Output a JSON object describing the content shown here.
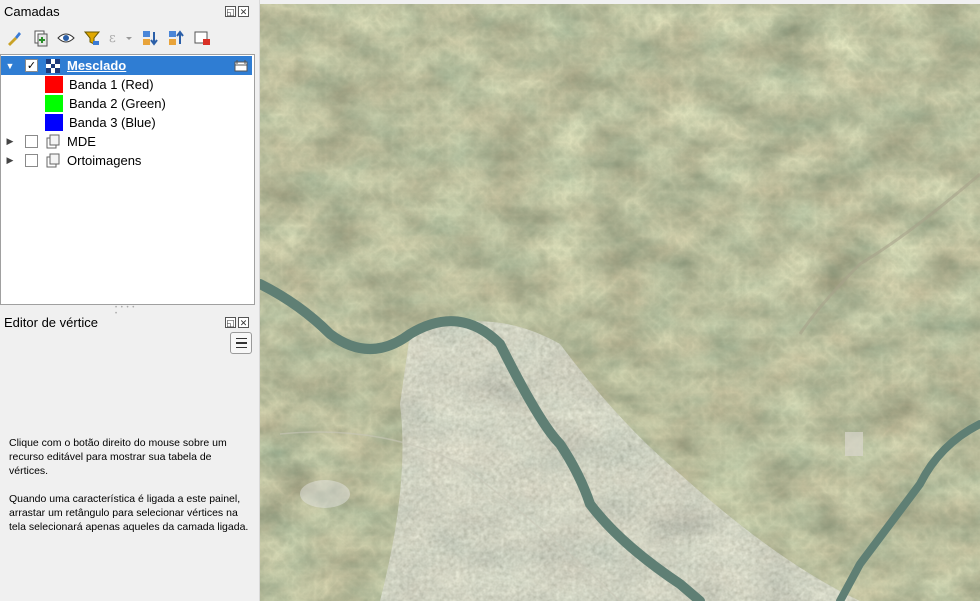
{
  "layers_panel": {
    "title": "Camadas",
    "toolbar": [
      {
        "name": "style-manager-icon"
      },
      {
        "name": "add-group-icon"
      },
      {
        "name": "visibility-eye-icon"
      },
      {
        "name": "filter-icon"
      },
      {
        "name": "expression-filter-icon"
      },
      {
        "name": "expand-all-icon"
      },
      {
        "name": "collapse-all-icon"
      },
      {
        "name": "remove-layer-icon"
      }
    ],
    "layers": [
      {
        "label": "Mesclado",
        "checked": "✓",
        "selected": true
      },
      {
        "label": "Banda 1 (Red)",
        "color": "#ff0000"
      },
      {
        "label": "Banda 2 (Green)",
        "color": "#00ff00"
      },
      {
        "label": "Banda 3 (Blue)",
        "color": "#0000ff"
      },
      {
        "label": "MDE",
        "checked": ""
      },
      {
        "label": "Ortoimagens",
        "checked": ""
      }
    ]
  },
  "vertex_editor": {
    "title": "Editor de vértice",
    "help_1": "Clique com o botão direito do mouse sobre um recurso editável para mostrar sua tabela de vértices.",
    "help_2": "Quando uma característica é ligada a este painel, arrastar um retângulo para selecionar vértices na tela selecionará apenas aqueles da camada ligada."
  },
  "colors": {
    "selection": "#2f7dd3",
    "river": "#5f7f74"
  }
}
